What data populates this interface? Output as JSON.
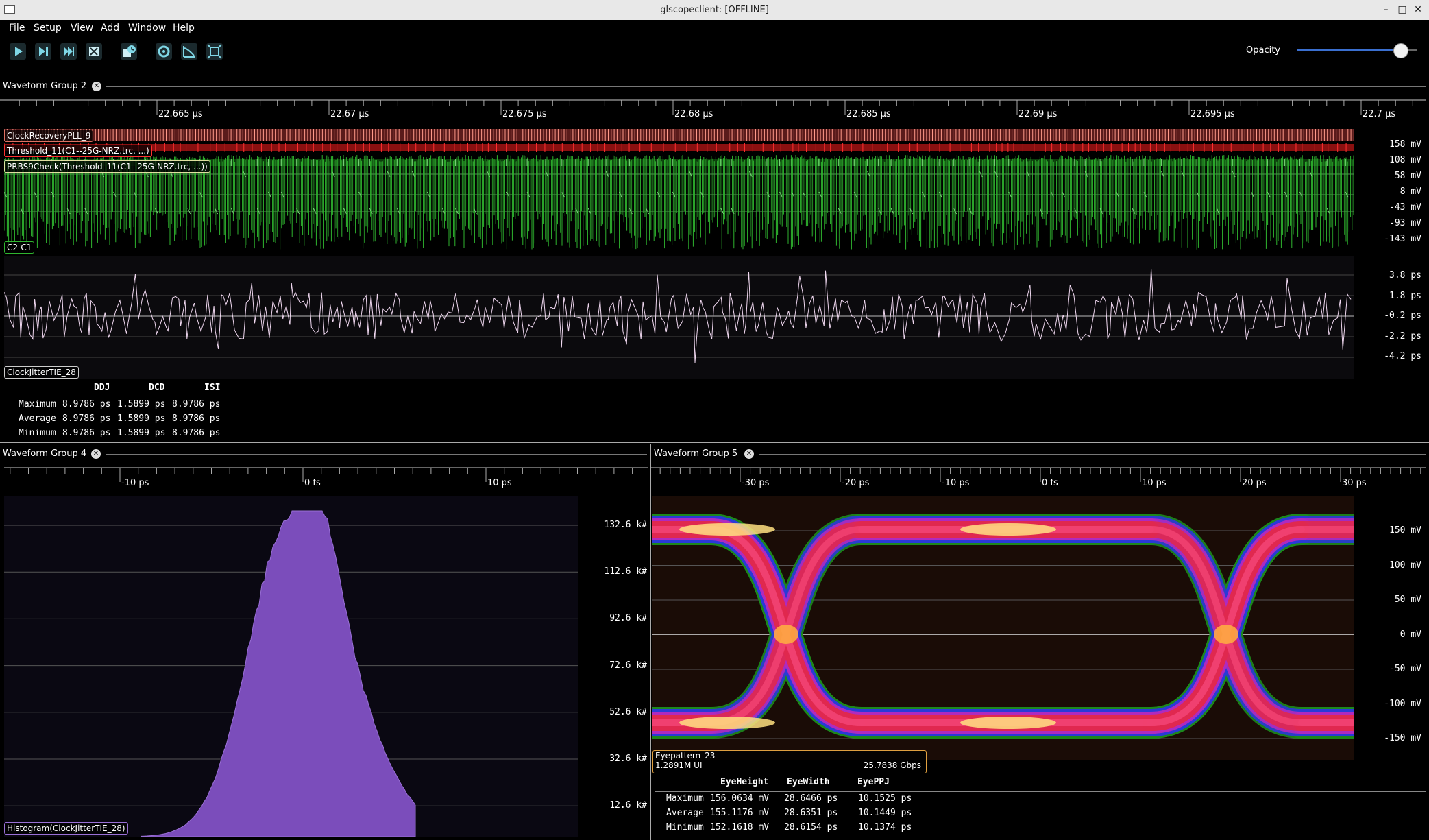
{
  "window": {
    "title": "glscopeclient: [OFFLINE]"
  },
  "menu": [
    "File",
    "Setup",
    "View",
    "Add",
    "Window",
    "Help"
  ],
  "toolbar": {
    "buttons": [
      "start-icon",
      "single-trigger-icon",
      "force-trigger-icon",
      "stop-icon",
      "history-icon",
      "refresh-icon",
      "curve-icon",
      "fullscreen-icon"
    ],
    "opacity_label": "Opacity",
    "opacity_value": 0.86
  },
  "group2": {
    "title": "Waveform Group 2",
    "time_ticks": [
      "22.665 μs",
      "22.67 μs",
      "22.675 μs",
      "22.68 μs",
      "22.685 μs",
      "22.69 μs",
      "22.695 μs",
      "22.7 μs"
    ],
    "channels": {
      "pll": "ClockRecoveryPLL_9",
      "threshold": "Threshold_11(C1--25G-NRZ.trc, ...)",
      "prbs": "PRBS9Check(Threshold_11(C1--25G-NRZ.trc, ...))",
      "c2c1": "C2-C1",
      "jitter": "ClockJitterTIE_28"
    },
    "volt_axis": [
      "158 mV",
      "108 mV",
      "58 mV",
      "8 mV",
      "-43 mV",
      "-93 mV",
      "-143 mV"
    ],
    "ps_axis": [
      "3.8 ps",
      "1.8 ps",
      "-0.2 ps",
      "-2.2 ps",
      "-4.2 ps"
    ],
    "stats": {
      "headers": [
        "DDJ",
        "DCD",
        "ISI"
      ],
      "rows": [
        {
          "label": "Maximum",
          "values": [
            "8.9786 ps",
            "1.5899 ps",
            "8.9786 ps"
          ]
        },
        {
          "label": "Average",
          "values": [
            "8.9786 ps",
            "1.5899 ps",
            "8.9786 ps"
          ]
        },
        {
          "label": "Minimum",
          "values": [
            "8.9786 ps",
            "1.5899 ps",
            "8.9786 ps"
          ]
        }
      ]
    }
  },
  "group4": {
    "title": "Waveform Group 4",
    "time_ticks": [
      "-10 ps",
      "0 fs",
      "10 ps"
    ],
    "y_axis": [
      "132.6 k#",
      "112.6 k#",
      "92.6 k#",
      "72.6 k#",
      "52.6 k#",
      "32.6 k#",
      "12.6 k#"
    ],
    "channel": "Histogram(ClockJitterTIE_28)"
  },
  "group5": {
    "title": "Waveform Group 5",
    "time_ticks": [
      "-30 ps",
      "-20 ps",
      "-10 ps",
      "0 fs",
      "10 ps",
      "20 ps",
      "30 ps"
    ],
    "y_axis": [
      "150 mV",
      "100 mV",
      "50 mV",
      "0 mV",
      "-50 mV",
      "-100 mV",
      "-150 mV"
    ],
    "channel": {
      "name": "Eyepattern_23",
      "ui": "1.2891M UI",
      "rate": "25.7838 Gbps"
    },
    "stats": {
      "headers": [
        "EyeHeight",
        "EyeWidth",
        "EyePPJ"
      ],
      "rows": [
        {
          "label": "Maximum",
          "values": [
            "156.0634 mV",
            "28.6466 ps",
            "10.1525 ps"
          ]
        },
        {
          "label": "Average",
          "values": [
            "155.1176 mV",
            "28.6351 ps",
            "10.1449 ps"
          ]
        },
        {
          "label": "Minimum",
          "values": [
            "152.1618 mV",
            "28.6154 ps",
            "10.1374 ps"
          ]
        }
      ]
    }
  }
}
